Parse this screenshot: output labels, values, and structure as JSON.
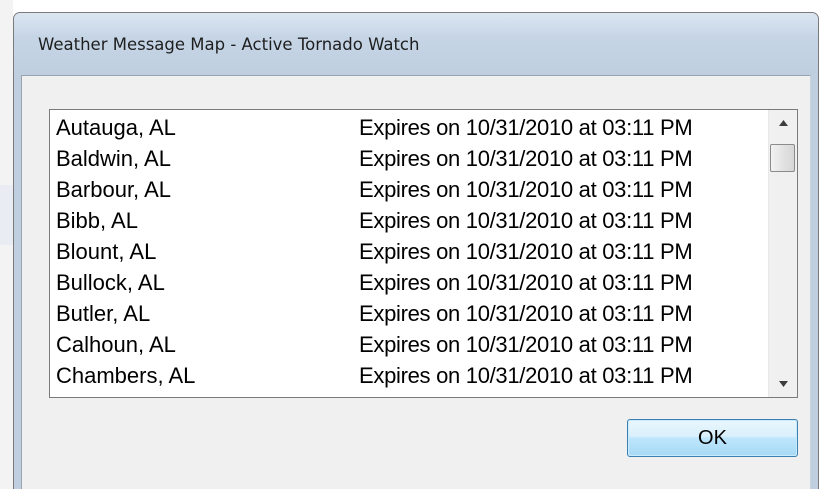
{
  "window": {
    "title": "Weather Message Map - Active Tornado Watch"
  },
  "list": {
    "rows": [
      {
        "county": "Autauga, AL",
        "expires": "Expires on 10/31/2010 at 03:11 PM"
      },
      {
        "county": "Baldwin, AL",
        "expires": "Expires on 10/31/2010 at 03:11 PM"
      },
      {
        "county": "Barbour, AL",
        "expires": "Expires on 10/31/2010 at 03:11 PM"
      },
      {
        "county": "Bibb, AL",
        "expires": "Expires on 10/31/2010 at 03:11 PM"
      },
      {
        "county": "Blount, AL",
        "expires": "Expires on 10/31/2010 at 03:11 PM"
      },
      {
        "county": "Bullock, AL",
        "expires": "Expires on 10/31/2010 at 03:11 PM"
      },
      {
        "county": "Butler, AL",
        "expires": "Expires on 10/31/2010 at 03:11 PM"
      },
      {
        "county": "Calhoun, AL",
        "expires": "Expires on 10/31/2010 at 03:11 PM"
      },
      {
        "county": "Chambers, AL",
        "expires": "Expires on 10/31/2010 at 03:11 PM"
      }
    ],
    "scroll_icons": {
      "up": "scroll-up-arrow-icon",
      "down": "scroll-down-arrow-icon"
    }
  },
  "buttons": {
    "ok_label": "OK"
  },
  "colors": {
    "title_bar": "#bfcfe0",
    "dialog_background": "#f0f0f0",
    "ok_button_border": "#3c7fb1"
  }
}
